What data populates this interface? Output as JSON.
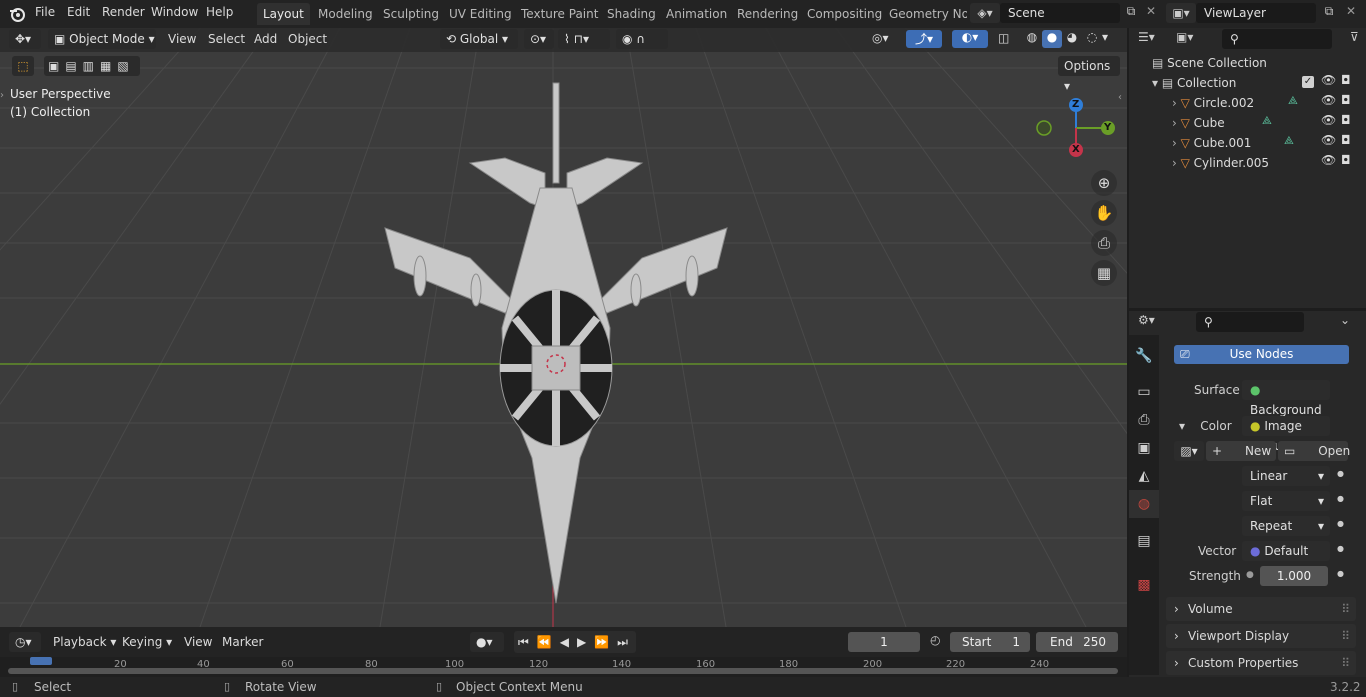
{
  "app": {
    "logo_icon": "blender-logo-icon",
    "version": "3.2.2"
  },
  "menus": [
    "File",
    "Edit",
    "Render",
    "Window",
    "Help"
  ],
  "workspaces": [
    "Layout",
    "Modeling",
    "Sculpting",
    "UV Editing",
    "Texture Paint",
    "Shading",
    "Animation",
    "Rendering",
    "Compositing",
    "Geometry Noc"
  ],
  "active_workspace": "Layout",
  "scene": {
    "label": "Scene"
  },
  "viewlayer": {
    "label": "ViewLayer"
  },
  "viewport": {
    "mode": "Object Mode",
    "menus": [
      "View",
      "Select",
      "Add",
      "Object"
    ],
    "orientation": "Global",
    "options_label": "Options",
    "perspective_label": "User Perspective",
    "collection_label": "(1) Collection",
    "gizmo": {
      "z": "Z",
      "y": "Y",
      "x": "X"
    },
    "colors": {
      "grid_bg": "#3c3c3c",
      "x_axis": "#c5344a",
      "y_axis": "#6a9e27",
      "z_axis": "#2f7ed8"
    }
  },
  "outliner": {
    "root": "Scene Collection",
    "collection": "Collection",
    "items": [
      {
        "name": "Circle.002",
        "icon": "mesh-data-icon"
      },
      {
        "name": "Cube",
        "icon": "mesh-data-icon"
      },
      {
        "name": "Cube.001",
        "icon": "mesh-data-icon"
      },
      {
        "name": "Cylinder.005",
        "icon": "none"
      }
    ]
  },
  "properties": {
    "use_nodes": "Use Nodes",
    "surface_label": "Surface",
    "surface_value": "Background",
    "color_label": "Color",
    "color_value": "Image Textu",
    "new_label": "New",
    "open_label": "Open",
    "interpolation": "Linear",
    "projection": "Flat",
    "extension": "Repeat",
    "vector_label": "Vector",
    "vector_value": "Default",
    "strength_label": "Strength",
    "strength_value": "1.000",
    "sections": [
      "Volume",
      "Viewport Display",
      "Custom Properties"
    ]
  },
  "timeline": {
    "menus": [
      "Playback",
      "Keying",
      "View",
      "Marker"
    ],
    "current_frame": "1",
    "start_label": "Start",
    "start_value": "1",
    "end_label": "End",
    "end_value": "250",
    "ruler": [
      "20",
      "40",
      "60",
      "80",
      "100",
      "120",
      "140",
      "160",
      "180",
      "200",
      "220",
      "240"
    ]
  },
  "status": {
    "select": "Select",
    "rotate": "Rotate View",
    "context": "Object Context Menu"
  }
}
